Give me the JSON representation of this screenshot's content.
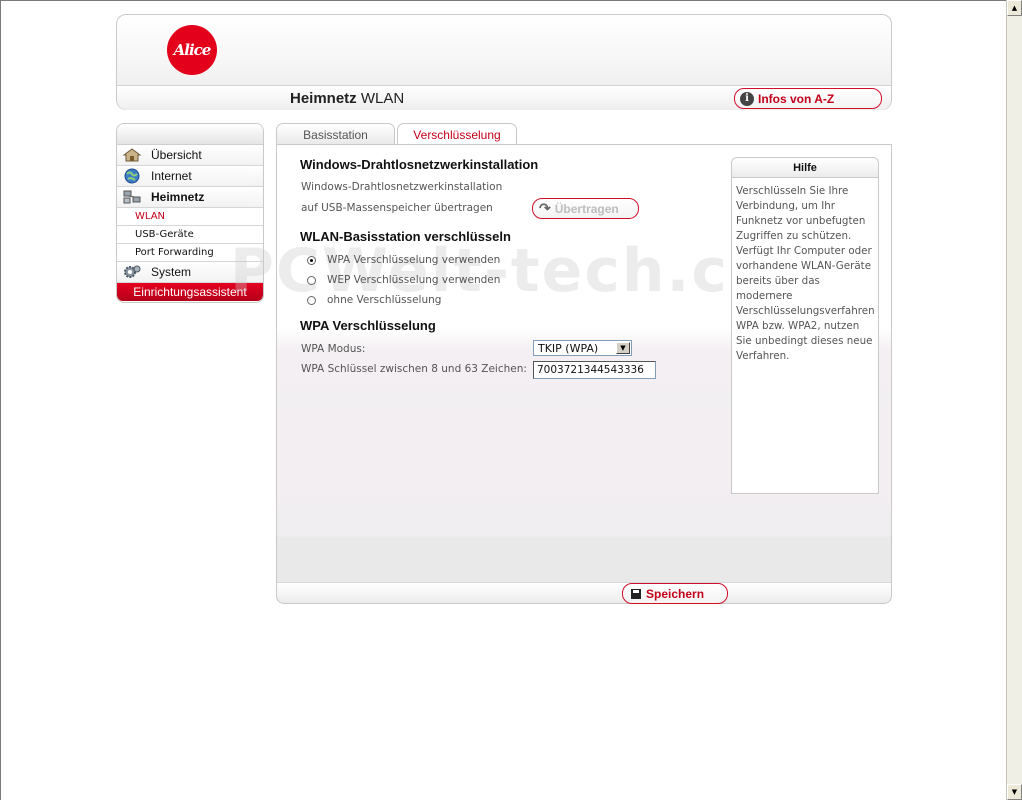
{
  "header": {
    "logo_text": "Alice",
    "title_bold": "Heimnetz",
    "title_rest": " WLAN",
    "info_button": "Infos von A-Z",
    "brand_color": "#e2001a"
  },
  "sidebar": {
    "items": [
      {
        "label": "Übersicht",
        "icon": "house-icon"
      },
      {
        "label": "Internet",
        "icon": "globe-icon"
      },
      {
        "label": "Heimnetz",
        "icon": "network-icon"
      }
    ],
    "sub_items": [
      {
        "label": "WLAN"
      },
      {
        "label": "USB-Geräte"
      },
      {
        "label": "Port Forwarding"
      }
    ],
    "system": {
      "label": "System",
      "icon": "gear-icon"
    },
    "wizard": "Einrichtungsassistent"
  },
  "tabs": [
    {
      "label": "Basisstation"
    },
    {
      "label": "Verschlüsselung"
    }
  ],
  "main": {
    "section1": {
      "title": "Windows-Drahtlosnetzwerkinstallation",
      "line1": "Windows-Drahtlosnetzwerkinstallation",
      "line2": "auf USB-Massenspeicher übertragen",
      "transfer_button": "Übertragen"
    },
    "section2": {
      "title": "WLAN-Basisstation verschlüsseln",
      "options": [
        {
          "label": "WPA Verschlüsselung verwenden",
          "selected": true
        },
        {
          "label": "WEP Verschlüsselung verwenden",
          "selected": false
        },
        {
          "label": "ohne Verschlüsselung",
          "selected": false
        }
      ]
    },
    "section3": {
      "title": "WPA Verschlüsselung",
      "mode_label": "WPA Modus:",
      "mode_value": "TKIP (WPA)",
      "key_label": "WPA Schlüssel zwischen 8 und 63 Zeichen:",
      "key_value": "7003721344543336"
    }
  },
  "help": {
    "title": "Hilfe",
    "text": "Verschlüsseln Sie Ihre Verbindung, um Ihr Funknetz vor unbefugten Zugriffen zu schützen. Verfügt Ihr Computer oder vorhandene WLAN-Geräte bereits über das modernere Verschlüsselungsverfahren WPA bzw. WPA2, nutzen Sie unbedingt dieses neue Verfahren."
  },
  "footer": {
    "save_button": "Speichern"
  },
  "watermark": "PCWelt-tech.com"
}
